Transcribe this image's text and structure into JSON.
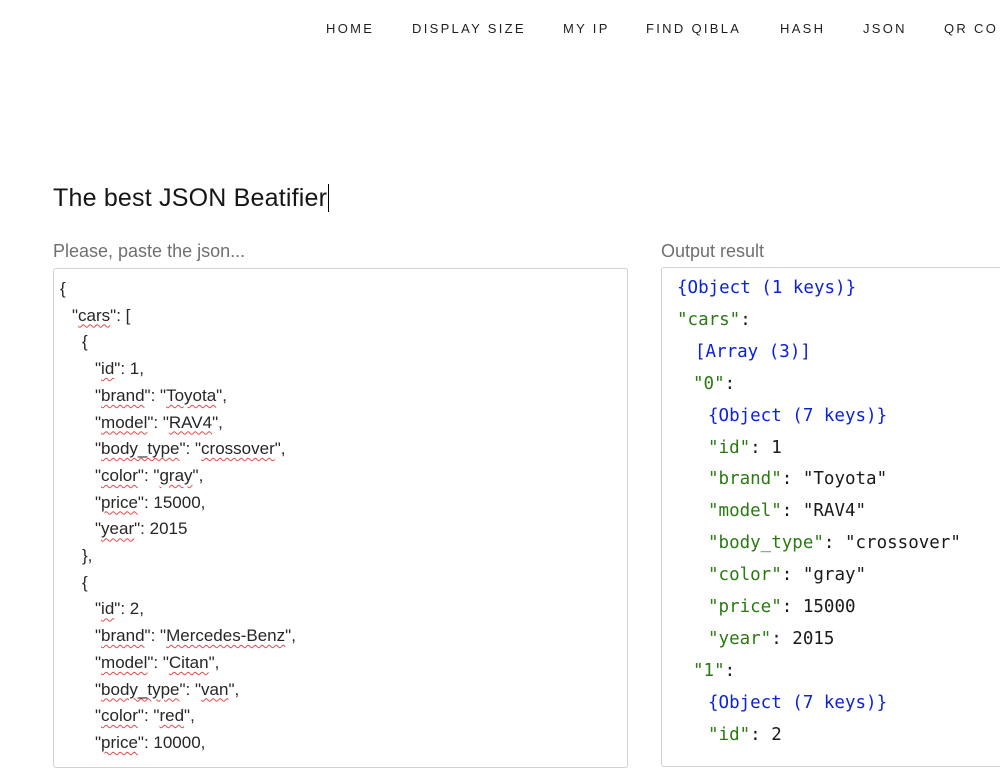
{
  "nav": {
    "items": [
      "HOME",
      "DISPLAY SIZE",
      "MY IP",
      "FIND QIBLA",
      "HASH",
      "JSON",
      "QR CO"
    ]
  },
  "page": {
    "title": "The best JSON Beatifier"
  },
  "input": {
    "label": "Please, paste the json...",
    "lines": [
      "{",
      "\"cars\": [",
      "{",
      "\"id\": 1,",
      "\"brand\": \"Toyota\",",
      "\"model\": \"RAV4\",",
      "\"body_type\": \"crossover\",",
      "\"color\": \"gray\",",
      "\"price\": 15000,",
      "\"year\": 2015",
      "},",
      "{",
      "\"id\": 2,",
      "\"brand\": \"Mercedes-Benz\",",
      "\"model\": \"Citan\",",
      "\"body_type\": \"van\",",
      "\"color\": \"red\",",
      "\"price\": 10000,"
    ]
  },
  "output": {
    "label": "Output result",
    "lines": [
      {
        "type": "{Object (1 keys)}"
      },
      {
        "key": "\"cars\"",
        "sep": ":"
      },
      {
        "type": "[Array (3)]"
      },
      {
        "key": "\"0\"",
        "sep": ":"
      },
      {
        "type": "{Object (7 keys)}"
      },
      {
        "key": "\"id\"",
        "sep": ": ",
        "value": "1"
      },
      {
        "key": "\"brand\"",
        "sep": ": ",
        "value": "\"Toyota\""
      },
      {
        "key": "\"model\"",
        "sep": ": ",
        "value": "\"RAV4\""
      },
      {
        "key": "\"body_type\"",
        "sep": ": ",
        "value": "\"crossover\""
      },
      {
        "key": "\"color\"",
        "sep": ": ",
        "value": "\"gray\""
      },
      {
        "key": "\"price\"",
        "sep": ": ",
        "value": "15000"
      },
      {
        "key": "\"year\"",
        "sep": ": ",
        "value": "2015"
      },
      {
        "key": "\"1\"",
        "sep": ":"
      },
      {
        "type": "{Object (7 keys)}"
      },
      {
        "key": "\"id\"",
        "sep": ": ",
        "value": "2"
      }
    ]
  },
  "colors": {
    "type_blue": "#0b22d8",
    "key_green": "#2a7a12",
    "spellcheck_red": "#e34a4a"
  }
}
